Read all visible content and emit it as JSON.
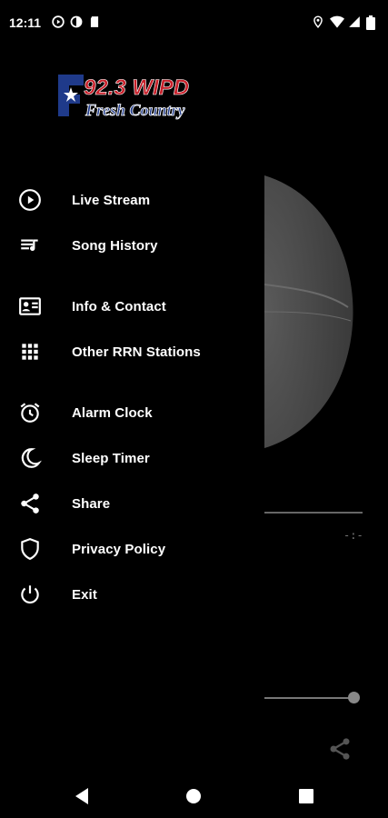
{
  "status_bar": {
    "time": "12:11",
    "left_icons": [
      "play-circle-icon",
      "app-icon",
      "sd-card-icon"
    ],
    "right_icons": [
      "location-icon",
      "wifi-icon",
      "signal-icon",
      "battery-icon"
    ]
  },
  "logo": {
    "line1": "92.3 WIPD",
    "line2": "Fresh Country",
    "colors": {
      "red": "#c8202a",
      "blue": "#1f3a8a",
      "white": "#ffffff"
    }
  },
  "menu": {
    "items": [
      {
        "label": "Live Stream",
        "icon": "play-circle-icon"
      },
      {
        "label": "Song History",
        "icon": "playlist-icon"
      },
      {
        "label": "Info & Contact",
        "icon": "contact-card-icon"
      },
      {
        "label": "Other RRN Stations",
        "icon": "grid-icon"
      },
      {
        "label": "Alarm Clock",
        "icon": "alarm-clock-icon"
      },
      {
        "label": "Sleep Timer",
        "icon": "moon-icon"
      },
      {
        "label": "Share",
        "icon": "share-icon"
      },
      {
        "label": "Privacy Policy",
        "icon": "shield-icon"
      },
      {
        "label": "Exit",
        "icon": "power-icon"
      }
    ]
  },
  "player": {
    "time_readout": "-:-",
    "volume_level": 1.0
  },
  "nav_bar": {
    "buttons": [
      "back-icon",
      "home-icon",
      "recents-icon"
    ]
  }
}
